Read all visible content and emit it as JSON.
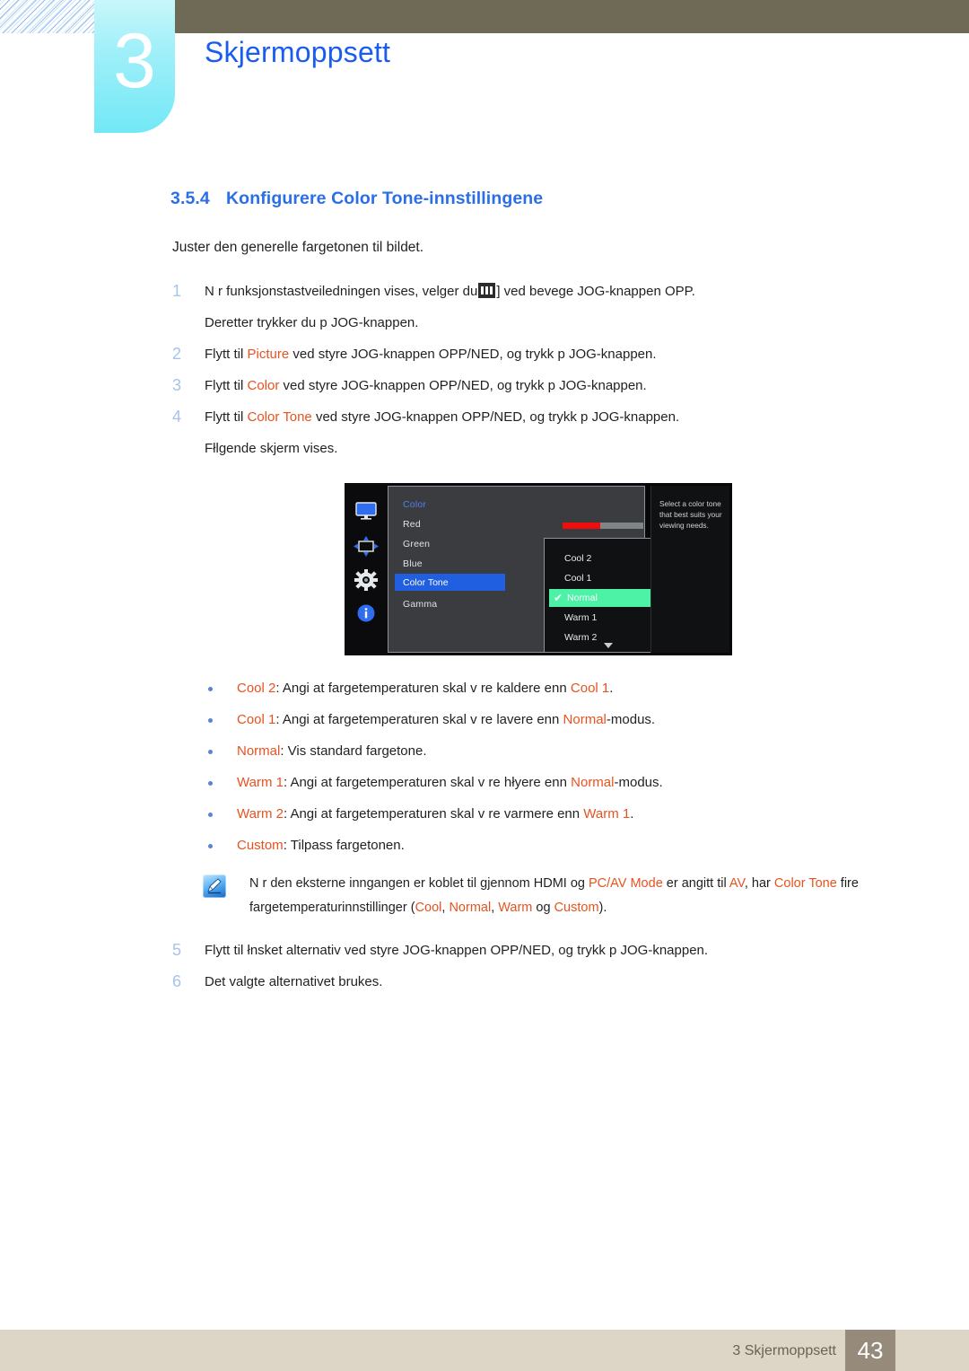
{
  "header": {
    "chapter_number": "3",
    "chapter_title": "Skjermoppsett"
  },
  "section": {
    "number": "3.5.4",
    "title": "Konfigurere Color Tone-innstillingene",
    "intro": "Juster den generelle fargetonen til bildet."
  },
  "steps": [
    {
      "marker": "1",
      "text_before_icon": "N r funksjonstastveiledningen vises, velger du",
      "icon": "menu-icon",
      "text_after_icon": "] ved   bevege JOG-knappen OPP.",
      "sub": "Deretter trykker du p  JOG-knappen."
    },
    {
      "marker": "2",
      "prefix": "Flytt til ",
      "keyword": "Picture",
      "suffix": " ved   styre JOG-knappen OPP/NED, og trykk p  JOG-knappen."
    },
    {
      "marker": "3",
      "prefix": "Flytt til ",
      "keyword": "Color",
      "suffix": " ved   styre JOG-knappen OPP/NED, og trykk p  JOG-knappen."
    },
    {
      "marker": "4",
      "prefix": "Flytt til ",
      "keyword": "Color Tone",
      "suffix": " ved   styre JOG-knappen OPP/NED, og trykk p  JOG-knappen.",
      "sub": "Fłlgende skjerm vises."
    },
    {
      "marker": "5",
      "text": "Flytt til łnsket alternativ ved   styre JOG-knappen OPP/NED, og trykk p  JOG-knappen."
    },
    {
      "marker": "6",
      "text": "Det valgte alternativet brukes."
    }
  ],
  "osd": {
    "rail_icons": [
      "monitor-icon",
      "screen-adjust-icon",
      "gear-icon",
      "info-icon"
    ],
    "menu_title": "Color",
    "menu_items": [
      "Red",
      "Green",
      "Blue",
      "Color Tone",
      "Gamma"
    ],
    "highlighted_item": "Color Tone",
    "slider_value": "50",
    "slider_percent": 47,
    "dropdown_options": [
      "Cool 2",
      "Cool 1",
      "Normal",
      "Warm 1",
      "Warm 2"
    ],
    "dropdown_selected": "Normal",
    "tooltip": "Select a color tone that best suits your viewing needs.",
    "colors": {
      "highlight_blue": "#1f5fe0",
      "selected_green": "#4df2a7",
      "slider_red": "#f20d0d",
      "title_blue": "#4f7ff2"
    }
  },
  "bullets": [
    {
      "keyword": "Cool 2",
      "mid": ": Angi at fargetemperaturen skal v re kaldere enn ",
      "keyword2": "Cool 1",
      "end": "."
    },
    {
      "keyword": "Cool 1",
      "mid": ": Angi at fargetemperaturen skal v re lavere enn ",
      "keyword2": "Normal",
      "end": "-modus."
    },
    {
      "keyword": "Normal",
      "mid": ": Vis standard fargetone.",
      "keyword2": "",
      "end": ""
    },
    {
      "keyword": "Warm 1",
      "mid": ": Angi at fargetemperaturen skal v re hłyere enn ",
      "keyword2": "Normal",
      "end": "-modus."
    },
    {
      "keyword": "Warm 2",
      "mid": ": Angi at fargetemperaturen skal v re varmere enn ",
      "keyword2": "Warm 1",
      "end": "."
    },
    {
      "keyword": "Custom",
      "mid": ": Tilpass fargetonen.",
      "keyword2": "",
      "end": ""
    }
  ],
  "note": {
    "icon": "note-pencil-icon",
    "p1_a": "N r den eksterne inngangen er koblet til gjennom HDMI og ",
    "p1_kw1": "PC/AV Mode",
    "p1_b": " er angitt til ",
    "p1_kw2": "AV",
    "p1_c": ", har ",
    "p1_kw3": "Color Tone",
    "p1_d": " fire fargetemperaturinnstillinger (",
    "p1_kw4": "Cool",
    "p1_e": ", ",
    "p1_kw5": "Normal",
    "p1_f": ", ",
    "p1_kw6": "Warm",
    "p1_g": " og ",
    "p1_kw7": "Custom",
    "p1_h": ")."
  },
  "footer": {
    "text": "3 Skjermoppsett",
    "page": "43"
  }
}
